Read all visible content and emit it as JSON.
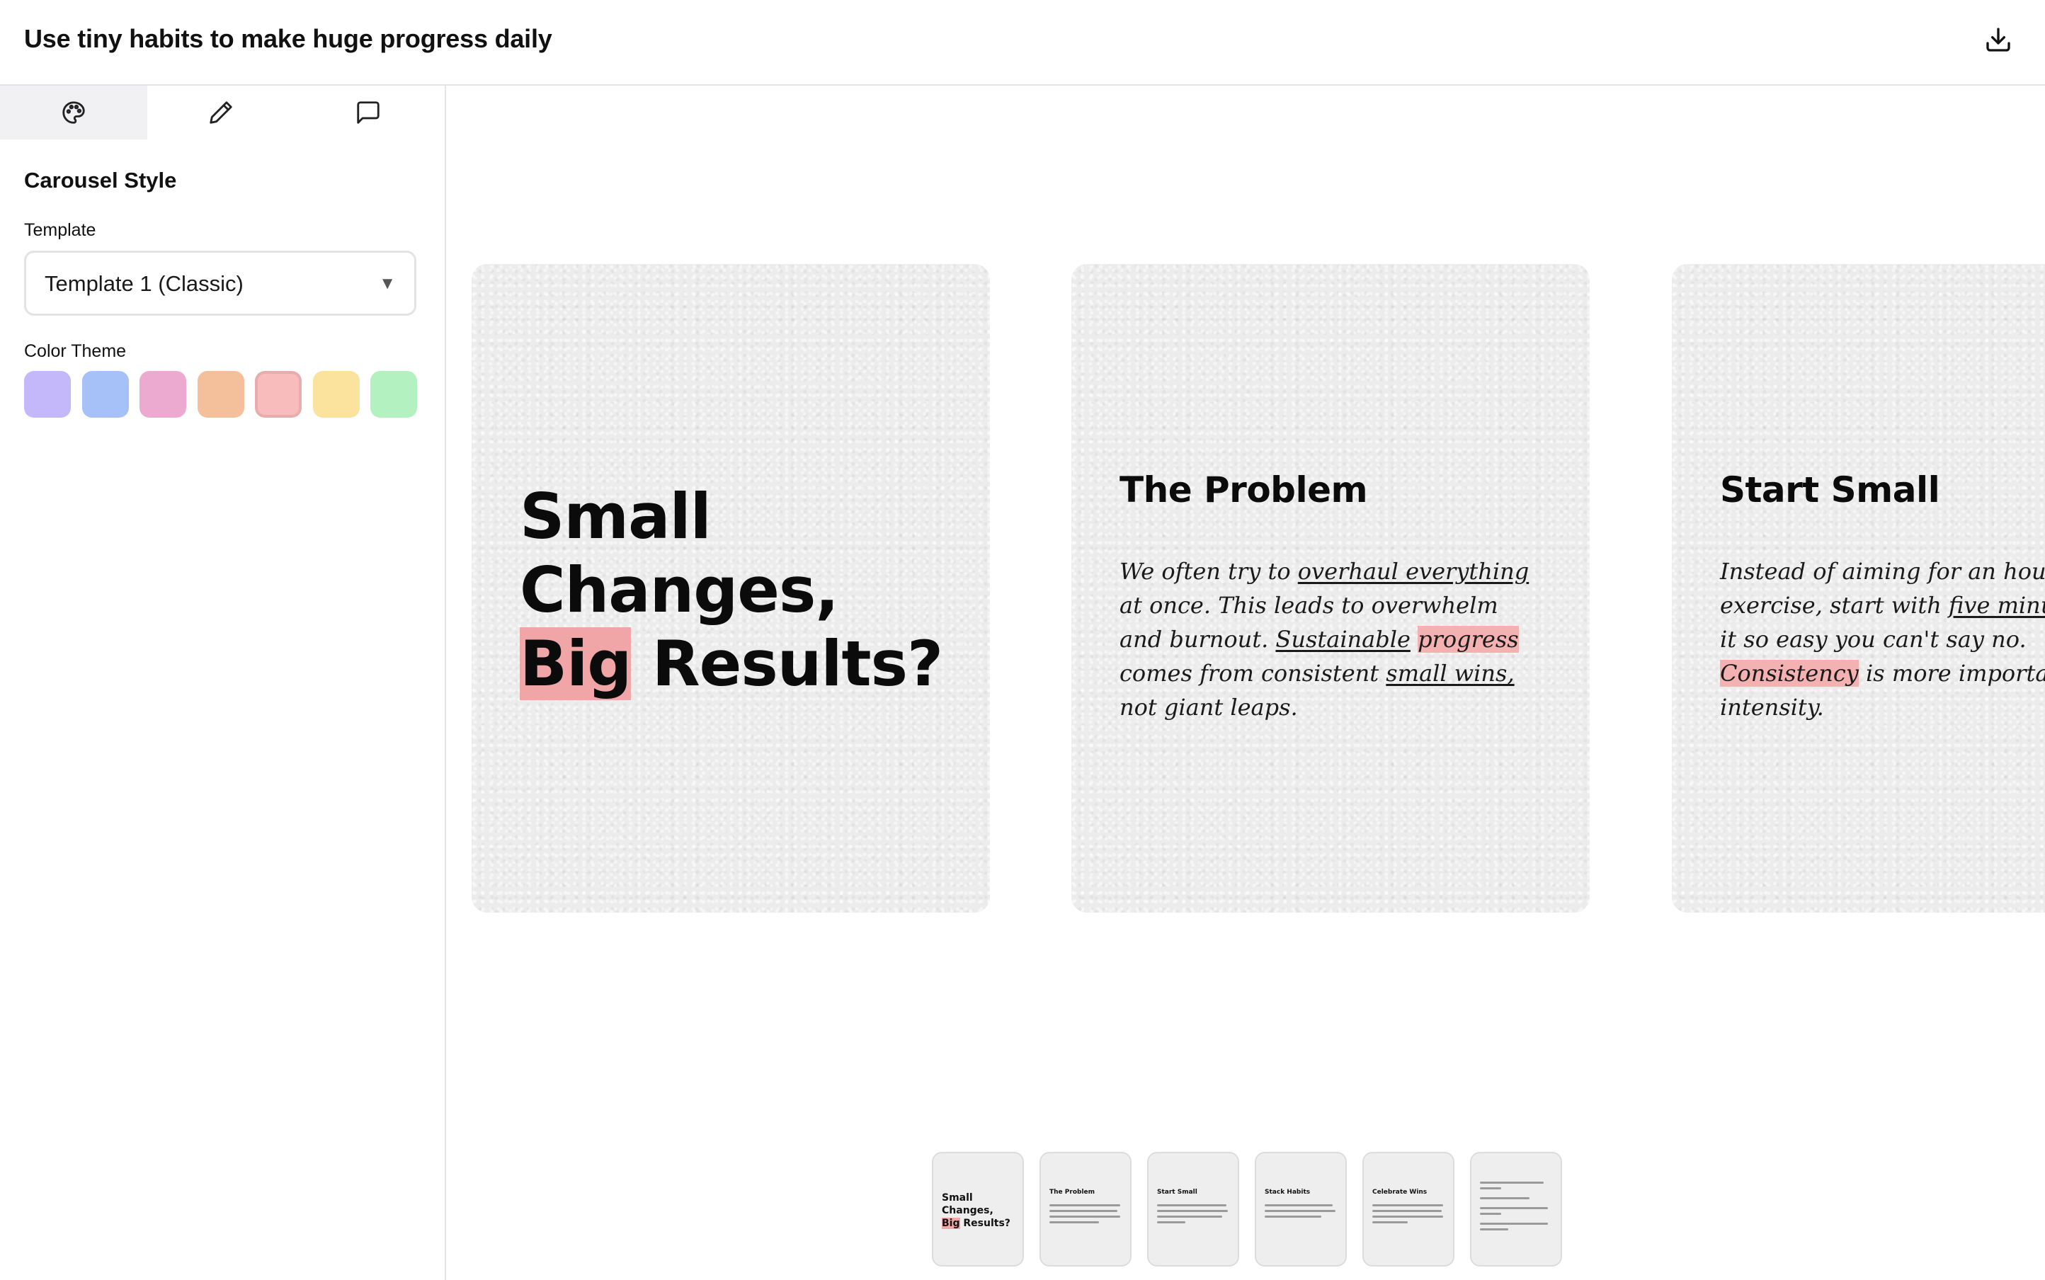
{
  "header": {
    "title": "Use tiny habits to make huge progress daily",
    "download_icon": "download-icon"
  },
  "sidebar": {
    "tabs": [
      {
        "name": "palette",
        "icon": "palette-icon",
        "active": true
      },
      {
        "name": "edit",
        "icon": "pencil-icon",
        "active": false
      },
      {
        "name": "comments",
        "icon": "message-square-icon",
        "active": false
      }
    ],
    "section_title": "Carousel Style",
    "template_label": "Template",
    "template_value": "Template 1 (Classic)",
    "color_theme_label": "Color Theme",
    "color_swatches": [
      "#c4b8fb",
      "#a6c0f8",
      "#edaad0",
      "#f3c09b",
      "#f9bcbc",
      "#fbe29d",
      "#b3f1c0"
    ],
    "selected_swatch_index": 4
  },
  "slides": [
    {
      "title_line1": "Small",
      "title_line2": "Changes,",
      "title_highlight": "Big",
      "title_rest": " Results?"
    },
    {
      "heading": "The Problem",
      "body": {
        "p1": "We often try to ",
        "u1": "overhaul everything",
        "p2": " at once. This leads to overwhelm and burnout. ",
        "u2": "Sustainable",
        "p3": " ",
        "h1": "progress",
        "p4": " comes from consistent ",
        "u3": "small wins,",
        "p5": " not giant leaps."
      }
    },
    {
      "heading": "Start Small",
      "body": {
        "line1": "Instead of aiming for an hou",
        "line2a": "exercise, start with ",
        "line2u": "five minut",
        "line3": "it so easy you can't say no.",
        "line4h": "Consistency",
        "line4b": " is more importan",
        "line5": "intensity."
      }
    }
  ],
  "thumbnails": [
    {
      "title_a": "Small",
      "title_b": "Changes,",
      "title_h": "Big",
      "title_c": " Results?"
    },
    {
      "heading": "The Problem"
    },
    {
      "heading": "Start Small"
    },
    {
      "heading": "Stack Habits"
    },
    {
      "heading": "Celebrate Wins"
    },
    {
      "heading": ""
    }
  ],
  "accent_highlight": "#f0a6a6"
}
